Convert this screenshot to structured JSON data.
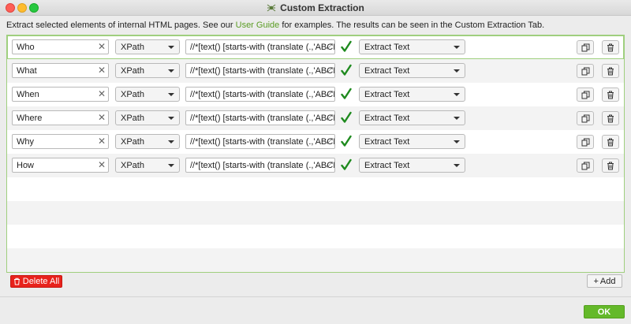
{
  "window": {
    "title": "Custom Extraction"
  },
  "intro": {
    "before": "Extract selected elements of internal HTML pages. See our ",
    "link": "User Guide",
    "after": " for examples. The results can be seen in the Custom Extraction Tab."
  },
  "rows": [
    {
      "name": "Who",
      "type": "XPath",
      "expression": "//*[text() [starts-with (translate (.,'ABCDEFGHIJKLMNOPQRSTUVWXYZ'",
      "valid": true,
      "extract": "Extract Text"
    },
    {
      "name": "What",
      "type": "XPath",
      "expression": "//*[text() [starts-with (translate (.,'ABCDEFGHIJKLMNOPQRSTUVWXYZ'",
      "valid": true,
      "extract": "Extract Text"
    },
    {
      "name": "When",
      "type": "XPath",
      "expression": "//*[text() [starts-with (translate (.,'ABCDEFGHIJKLMNOPQRSTUVWXYZ'",
      "valid": true,
      "extract": "Extract Text"
    },
    {
      "name": "Where",
      "type": "XPath",
      "expression": "//*[text() [starts-with (translate (.,'ABCDEFGHIJKLMNOPQRSTUVWXYZ'",
      "valid": true,
      "extract": "Extract Text"
    },
    {
      "name": "Why",
      "type": "XPath",
      "expression": "//*[text() [starts-with (translate (.,'ABCDEFGHIJKLMNOPQRSTUVWXYZ'",
      "valid": true,
      "extract": "Extract Text"
    },
    {
      "name": "How",
      "type": "XPath",
      "expression": "//*[text() [starts-with (translate (.,'ABCDEFGHIJKLMNOPQRSTUVWXYZ'",
      "valid": true,
      "extract": "Extract Text"
    }
  ],
  "buttons": {
    "delete_all": "Delete All",
    "add": "Add",
    "ok": "OK"
  },
  "colors": {
    "accent": "#64b92a",
    "danger": "#e8221c",
    "check": "#1e8a1e",
    "link": "#5a9c23"
  }
}
